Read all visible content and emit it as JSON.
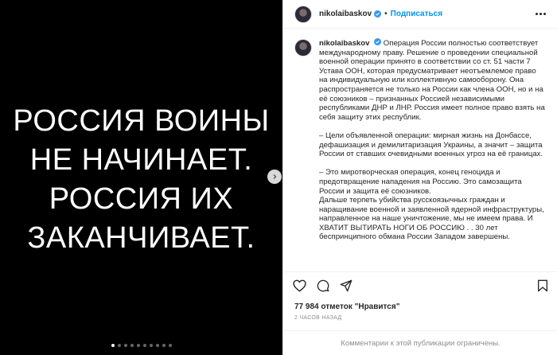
{
  "media": {
    "lines": [
      "РОССИЯ ВОИНЫ",
      "НЕ НАЧИНАЕТ.",
      "РОССИЯ ИХ",
      "ЗАКАНЧИВАЕТ."
    ],
    "dots_total": 10,
    "active_dot": 0
  },
  "header": {
    "username": "nikolaibaskov",
    "separator": "•",
    "follow_label": "Подписаться"
  },
  "caption": {
    "username": "nikolaibaskov",
    "paragraphs": [
      "Операция России полностью соответствует международному праву. Решение о проведении специальной военной операции принято в соответствии со ст. 51 части 7 Устава ООН, которая предусматривает неотъемлемое право на индивидуальную или коллективную самооборону. Она распространяется не только на России как члена ООН, но и на её союзников – признанных Россией независимыми республиками ДНР и ЛНР. Россия имеет полное право взять на себя защиту этих республик.",
      "– Цели объявленной операции: мирная жизнь на Донбассе, дефашизация и демилитаризация Украины, а значит – защита России от ставших очевидными военных угроз на её границах.",
      "– Это миротворческая операция, конец геноцида и предотвращение нападения на Россию. Это самозащита России и защита её союзников.\nДальше терпеть убийства русскоязычных граждан и наращивание военной и заявленной ядерной инфраструктуры, направленное на наше уничтожение, мы не имеем права. И ХВАТИТ ВЫТИРАТЬ НОГИ ОБ РОССИЮ . . 30 лет беспринципного обмана России Западом завершены."
    ]
  },
  "stats": {
    "likes": "77 984 отметок \"Нравится\"",
    "time": "2 ЧАСОВ НАЗАД"
  },
  "footer": {
    "comments_notice": "Комментарии к этой публикации ограничены."
  },
  "colors": {
    "accent": "#0095f6",
    "text": "#262626",
    "muted": "#8e8e8e"
  },
  "icons": [
    "next-arrow-icon",
    "verified-icon",
    "more-icon",
    "heart-icon",
    "comment-icon",
    "share-icon",
    "bookmark-icon"
  ]
}
